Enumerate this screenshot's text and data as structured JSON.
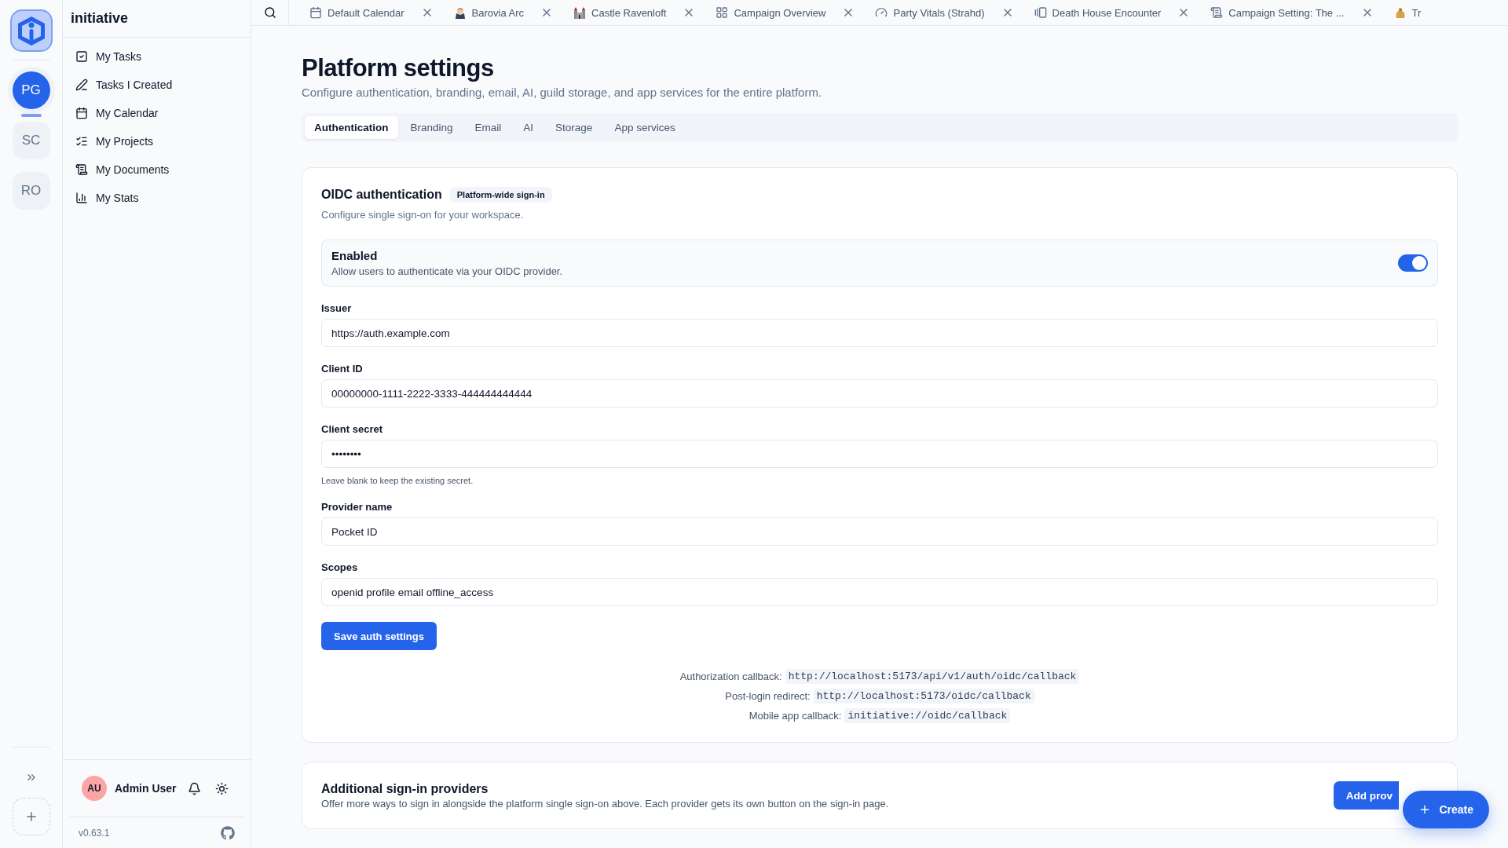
{
  "rail": {
    "workspaces": [
      {
        "initials": "PG",
        "selected": true
      },
      {
        "initials": "SC",
        "selected": false
      },
      {
        "initials": "RO",
        "selected": false
      }
    ]
  },
  "sidebar": {
    "title": "initiative",
    "items": [
      {
        "label": "My Tasks",
        "kind": "tasks"
      },
      {
        "label": "Tasks I Created",
        "kind": "pen"
      },
      {
        "label": "My Calendar",
        "kind": "calendar"
      },
      {
        "label": "My Projects",
        "kind": "projects"
      },
      {
        "label": "My Documents",
        "kind": "documents"
      },
      {
        "label": "My Stats",
        "kind": "stats"
      }
    ],
    "user": {
      "initials": "AU",
      "name": "Admin User"
    },
    "version": "v0.63.1"
  },
  "open_tabs": [
    {
      "label": "Default Calendar",
      "kind": "calendar"
    },
    {
      "label": "Barovia Arc",
      "kind": "character"
    },
    {
      "label": "Castle Ravenloft",
      "kind": "castle"
    },
    {
      "label": "Campaign Overview",
      "kind": "board"
    },
    {
      "label": "Party Vitals (Strahd)",
      "kind": "gauge"
    },
    {
      "label": "Death House Encounter",
      "kind": "slides"
    },
    {
      "label": "Campaign Setting: The ...",
      "kind": "scroll"
    },
    {
      "label": "Tr",
      "kind": "bag"
    }
  ],
  "page": {
    "title": "Platform settings",
    "subtitle": "Configure authentication, branding, email, AI, guild storage, and app services for the entire platform.",
    "tabs": [
      {
        "label": "Authentication",
        "selected": true
      },
      {
        "label": "Branding",
        "selected": false
      },
      {
        "label": "Email",
        "selected": false
      },
      {
        "label": "AI",
        "selected": false
      },
      {
        "label": "Storage",
        "selected": false
      },
      {
        "label": "App services",
        "selected": false
      }
    ],
    "oidc": {
      "title": "OIDC authentication",
      "badge": "Platform-wide sign-in",
      "description": "Configure single sign-on for your workspace.",
      "enabled": {
        "label": "Enabled",
        "description": "Allow users to authenticate via your OIDC provider.",
        "on": true
      },
      "fields": [
        {
          "label": "Issuer",
          "value": "https://auth.example.com"
        },
        {
          "label": "Client ID",
          "value": "00000000-1111-2222-3333-444444444444"
        },
        {
          "label": "Client secret",
          "value": "••••••••",
          "hint": "Leave blank to keep the existing secret."
        },
        {
          "label": "Provider name",
          "value": "Pocket ID"
        },
        {
          "label": "Scopes",
          "value": "openid profile email offline_access"
        }
      ],
      "save_button": "Save auth settings",
      "callbacks": [
        {
          "label": "Authorization callback:",
          "value": "http://localhost:5173/api/v1/auth/oidc/callback"
        },
        {
          "label": "Post-login redirect:",
          "value": "http://localhost:5173/oidc/callback"
        },
        {
          "label": "Mobile app callback:",
          "value": "initiative://oidc/callback"
        }
      ]
    },
    "providers": {
      "title": "Additional sign-in providers",
      "description": "Offer more ways to sign in alongside the platform single sign-on above. Each provider gets its own button on the sign-in page.",
      "button": "Add prov"
    }
  },
  "fab": {
    "label": "Create"
  }
}
